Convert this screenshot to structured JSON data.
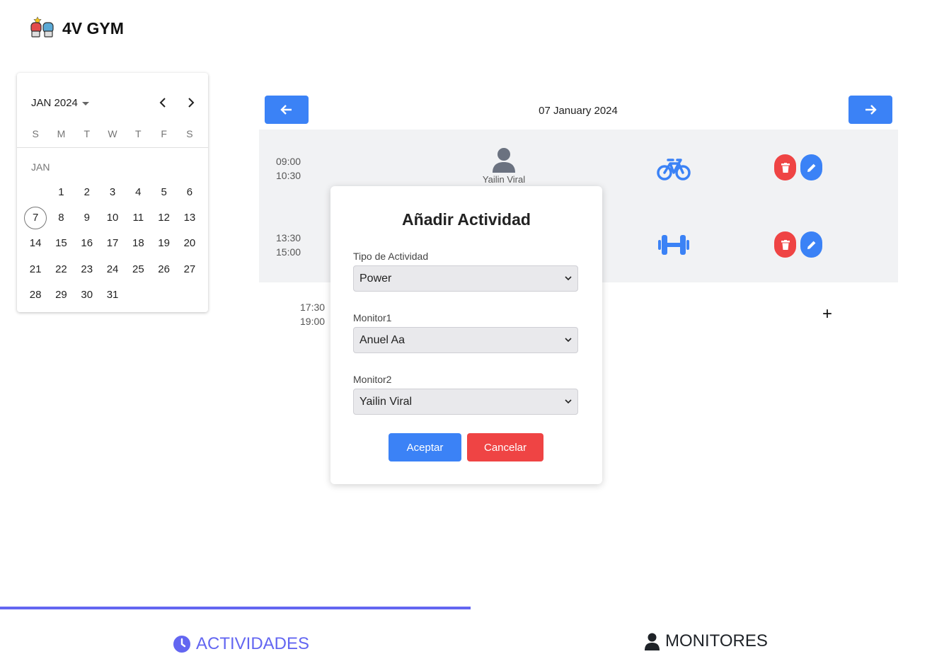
{
  "app": {
    "title": "4V GYM",
    "logo_icon": "boxing-gloves-icon"
  },
  "calendar": {
    "month_year": "JAN 2024",
    "weekdays": [
      "S",
      "M",
      "T",
      "W",
      "T",
      "F",
      "S"
    ],
    "month_label": "JAN",
    "leading_blanks": 1,
    "days": [
      "1",
      "2",
      "3",
      "4",
      "5",
      "6",
      "7",
      "8",
      "9",
      "10",
      "11",
      "12",
      "13",
      "14",
      "15",
      "16",
      "17",
      "18",
      "19",
      "20",
      "21",
      "22",
      "23",
      "24",
      "25",
      "26",
      "27",
      "28",
      "29",
      "30",
      "31"
    ],
    "today": "7"
  },
  "day_view": {
    "date": "07 January 2024",
    "slots": [
      {
        "start": "09:00",
        "end": "10:30",
        "monitor": "Yailin Viral",
        "activity_icon": "bicycle-icon"
      },
      {
        "start": "13:30",
        "end": "15:00",
        "activity_icon": "dumbbell-icon"
      },
      {
        "start": "17:30",
        "end": "19:00",
        "add_label": "+"
      }
    ]
  },
  "modal": {
    "title": "Añadir Actividad",
    "tipo_label": "Tipo de Actividad",
    "tipo_value": "Power",
    "monitor1_label": "Monitor1",
    "monitor1_value": "Anuel Aa",
    "monitor2_label": "Monitor2",
    "monitor2_value": "Yailin Viral",
    "accept_label": "Aceptar",
    "cancel_label": "Cancelar"
  },
  "tabs": {
    "activities_label": "ACTIVIDADES",
    "monitors_label": "MONITORES",
    "active": "ACTIVIDADES"
  },
  "colors": {
    "primary_blue": "#3b82f6",
    "danger_red": "#ef4444",
    "tab_indigo": "#6366f1",
    "schedule_bg": "#f1f2f4"
  }
}
